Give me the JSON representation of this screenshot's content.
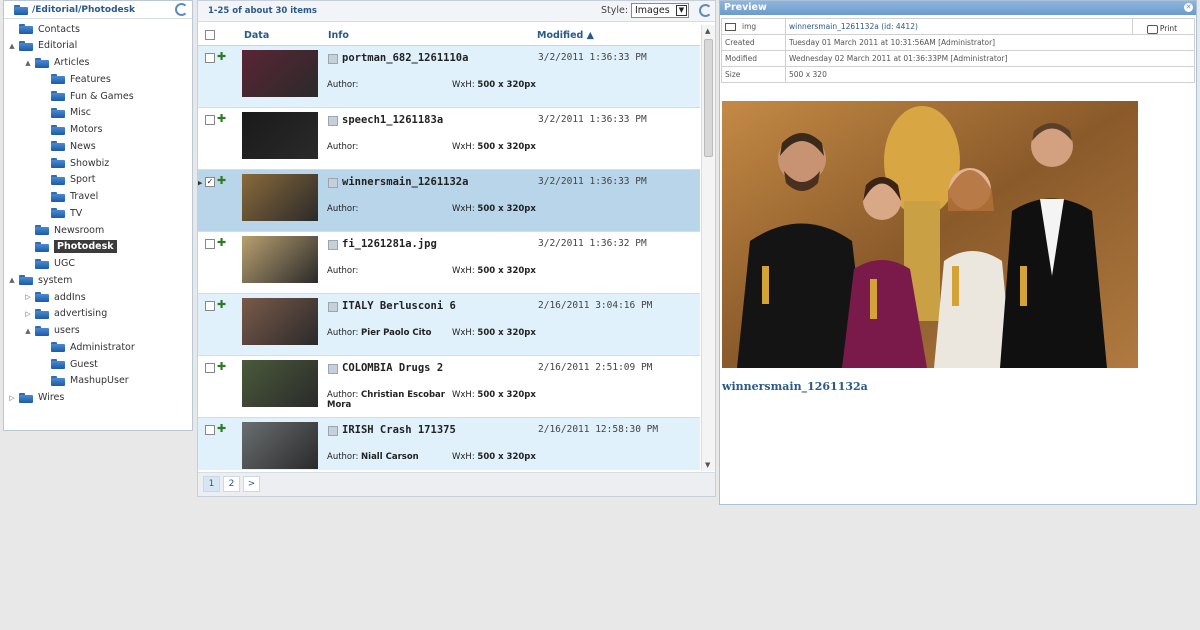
{
  "tree": {
    "path": "/Editorial/Photodesk",
    "items": [
      {
        "label": "Contacts",
        "depth": 0,
        "toggle": ""
      },
      {
        "label": "Editorial",
        "depth": 0,
        "toggle": "▲"
      },
      {
        "label": "Articles",
        "depth": 1,
        "toggle": "▲"
      },
      {
        "label": "Features",
        "depth": 2,
        "toggle": ""
      },
      {
        "label": "Fun & Games",
        "depth": 2,
        "toggle": ""
      },
      {
        "label": "Misc",
        "depth": 2,
        "toggle": ""
      },
      {
        "label": "Motors",
        "depth": 2,
        "toggle": ""
      },
      {
        "label": "News",
        "depth": 2,
        "toggle": ""
      },
      {
        "label": "Showbiz",
        "depth": 2,
        "toggle": ""
      },
      {
        "label": "Sport",
        "depth": 2,
        "toggle": ""
      },
      {
        "label": "Travel",
        "depth": 2,
        "toggle": ""
      },
      {
        "label": "TV",
        "depth": 2,
        "toggle": ""
      },
      {
        "label": "Newsroom",
        "depth": 1,
        "toggle": ""
      },
      {
        "label": "Photodesk",
        "depth": 1,
        "toggle": "",
        "selected": true
      },
      {
        "label": "UGC",
        "depth": 1,
        "toggle": ""
      },
      {
        "label": "system",
        "depth": 0,
        "toggle": "▲"
      },
      {
        "label": "addIns",
        "depth": 1,
        "toggle": "▷"
      },
      {
        "label": "advertising",
        "depth": 1,
        "toggle": "▷"
      },
      {
        "label": "users",
        "depth": 1,
        "toggle": "▲"
      },
      {
        "label": "Administrator",
        "depth": 2,
        "toggle": ""
      },
      {
        "label": "Guest",
        "depth": 2,
        "toggle": ""
      },
      {
        "label": "MashupUser",
        "depth": 2,
        "toggle": ""
      },
      {
        "label": "Wires",
        "depth": 0,
        "toggle": "▷"
      }
    ]
  },
  "grid": {
    "count_text": "1-25 of about 30 items",
    "style_label": "Style:",
    "style_value": "Images",
    "columns": {
      "data": "Data",
      "info": "Info",
      "modified": "Modified ▲"
    },
    "rows": [
      {
        "title": "portman_682_1261110a",
        "date": "3/2/2011 1:36:33 PM",
        "author_label": "Author:",
        "author": "",
        "size_label": "WxH:",
        "size": "500 x 320px",
        "style": "alt",
        "checked": false,
        "thumb": "#5a2535"
      },
      {
        "title": "speech1_1261183a",
        "date": "3/2/2011 1:36:33 PM",
        "author_label": "Author:",
        "author": "",
        "size_label": "WxH:",
        "size": "500 x 320px",
        "style": "white",
        "checked": false,
        "thumb": "#1a1a1a"
      },
      {
        "title": "winnersmain_1261132a",
        "date": "3/2/2011 1:36:33 PM",
        "author_label": "Author:",
        "author": "",
        "size_label": "WxH:",
        "size": "500 x 320px",
        "style": "sel",
        "checked": true,
        "thumb": "#8a6a3a"
      },
      {
        "title": "fi_1261281a.jpg",
        "date": "3/2/2011 1:36:32 PM",
        "author_label": "Author:",
        "author": "",
        "size_label": "WxH:",
        "size": "500 x 320px",
        "style": "white",
        "checked": false,
        "thumb": "#b8a070"
      },
      {
        "title": "ITALY Berlusconi 6",
        "date": "2/16/2011 3:04:16 PM",
        "author_label": "Author:",
        "author": "Pier Paolo Cito",
        "size_label": "WxH:",
        "size": "500 x 320px",
        "style": "alt",
        "checked": false,
        "thumb": "#7a5a4a"
      },
      {
        "title": "COLOMBIA Drugs 2",
        "date": "2/16/2011 2:51:09 PM",
        "author_label": "Author:",
        "author": "Christian Escobar Mora",
        "size_label": "WxH:",
        "size": "500 x 320px",
        "style": "white",
        "checked": false,
        "thumb": "#4a5a3a"
      },
      {
        "title": "IRISH Crash 171375",
        "date": "2/16/2011 12:58:30 PM",
        "author_label": "Author:",
        "author": "Niall Carson",
        "size_label": "WxH:",
        "size": "500 x 320px",
        "style": "alt",
        "checked": false,
        "thumb": "#6a6e70"
      }
    ],
    "pager": {
      "pages": [
        "1",
        "2"
      ],
      "next": ">",
      "current": "1"
    }
  },
  "preview": {
    "title": "Preview",
    "img_label": "img",
    "name_link": "winnersmain_1261132a (id: 4412)",
    "print_label": "Print",
    "meta": [
      {
        "key": "Created",
        "value": "Tuesday 01 March 2011 at 10:31:56AM [Administrator]"
      },
      {
        "key": "Modified",
        "value": "Wednesday 02 March 2011 at 01:36:33PM [Administrator]"
      },
      {
        "key": "Size",
        "value": "500 x 320"
      }
    ],
    "caption": "winnersmain_1261132a"
  }
}
